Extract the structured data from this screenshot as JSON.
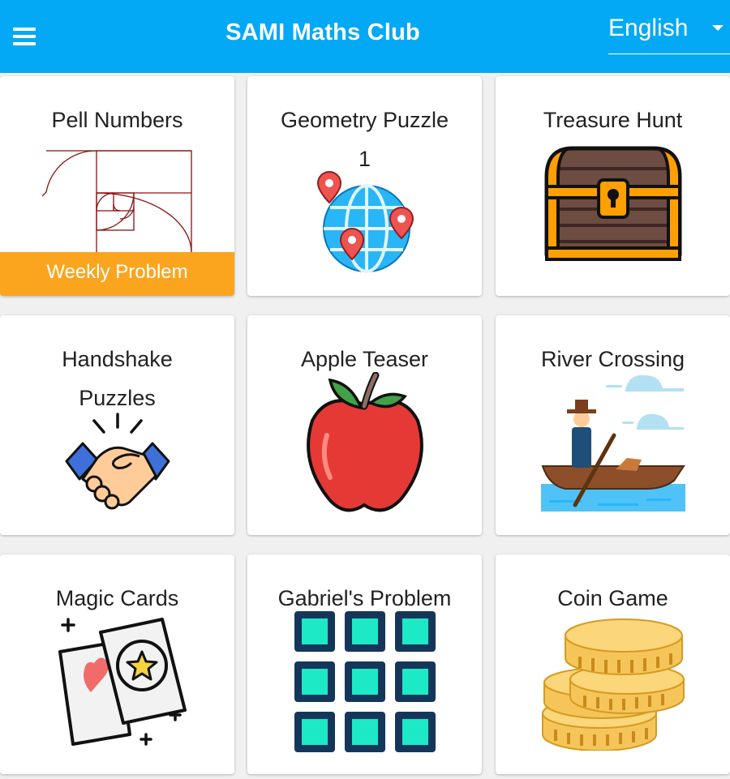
{
  "appbar": {
    "title": "SAMI Maths Club",
    "menu_icon": "menu-icon",
    "language": "English",
    "background": "#03a9f4"
  },
  "cards": [
    {
      "title": "Pell Numbers",
      "icon": "golden-spiral-icon",
      "badge": "Weekly Problem"
    },
    {
      "title": "Geometry Puzzle 1",
      "icon": "globe-pins-icon"
    },
    {
      "title": "Treasure Hunt",
      "icon": "treasure-chest-icon"
    },
    {
      "title": "Handshake Puzzles",
      "icon": "handshake-icon"
    },
    {
      "title": "Apple Teaser",
      "icon": "apple-icon"
    },
    {
      "title": "River Crossing",
      "icon": "boat-icon"
    },
    {
      "title": "Magic Cards",
      "icon": "magic-cards-icon"
    },
    {
      "title": "Gabriel's Problem",
      "icon": "grid-squares-icon"
    },
    {
      "title": "Coin Game",
      "icon": "coins-icon"
    }
  ],
  "colors": {
    "accent": "#03a9f4",
    "badge": "#fba51e"
  }
}
